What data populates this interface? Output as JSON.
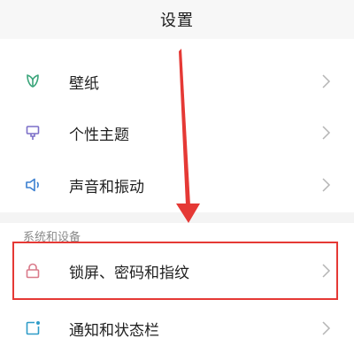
{
  "header": {
    "title": "设置"
  },
  "items": [
    {
      "label": "壁纸",
      "icon": "wallpaper-icon"
    },
    {
      "label": "个性主题",
      "icon": "theme-icon"
    },
    {
      "label": "声音和振动",
      "icon": "sound-icon"
    }
  ],
  "section": {
    "title": "系统和设备"
  },
  "system_items": [
    {
      "label": "锁屏、密码和指纹",
      "icon": "lock-icon"
    },
    {
      "label": "通知和状态栏",
      "icon": "notification-icon"
    }
  ],
  "colors": {
    "highlight": "#e53935",
    "arrow": "#e53935",
    "icon_green": "#3aa57a",
    "icon_purple": "#7c6fc8",
    "icon_blue": "#3a7fd0",
    "icon_pink": "#d97a8a",
    "icon_teal": "#2f9cc8"
  }
}
